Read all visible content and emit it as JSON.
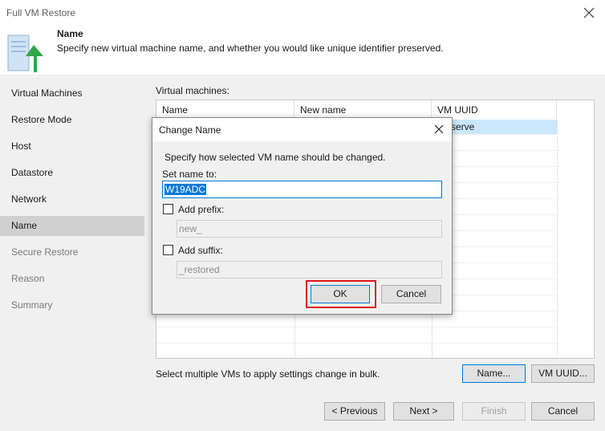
{
  "window": {
    "title": "Full VM Restore"
  },
  "header": {
    "title": "Name",
    "subtitle": "Specify new virtual machine name, and whether you would like unique identifier preserved."
  },
  "steps": [
    {
      "label": "Virtual Machines"
    },
    {
      "label": "Restore Mode"
    },
    {
      "label": "Host"
    },
    {
      "label": "Datastore"
    },
    {
      "label": "Network"
    },
    {
      "label": "Name"
    },
    {
      "label": "Secure Restore"
    },
    {
      "label": "Reason"
    },
    {
      "label": "Summary"
    }
  ],
  "selected_step": "Name",
  "vms": {
    "label": "Virtual machines:",
    "columns": [
      "Name",
      "New name",
      "VM UUID"
    ],
    "visible_cell_fragment": "serve",
    "hint": "Select multiple VMs to apply settings change in bulk.",
    "name_button": "Name...",
    "uuid_button": "VM UUID..."
  },
  "footer": {
    "previous": "< Previous",
    "next": "Next >",
    "finish": "Finish",
    "cancel": "Cancel"
  },
  "dialog": {
    "title": "Change Name",
    "instruction": "Specify how selected VM name should be changed.",
    "set_name_label": "Set name to:",
    "set_name_value": "W19ADC",
    "add_prefix_label": "Add prefix:",
    "prefix_placeholder": "new_",
    "add_suffix_label": "Add suffix:",
    "suffix_placeholder": "_restored",
    "ok": "OK",
    "cancel": "Cancel"
  },
  "colors": {
    "accent": "#0078d7",
    "highlight_box": "#e0161e",
    "wizard_arrow": "#2ea84a"
  }
}
